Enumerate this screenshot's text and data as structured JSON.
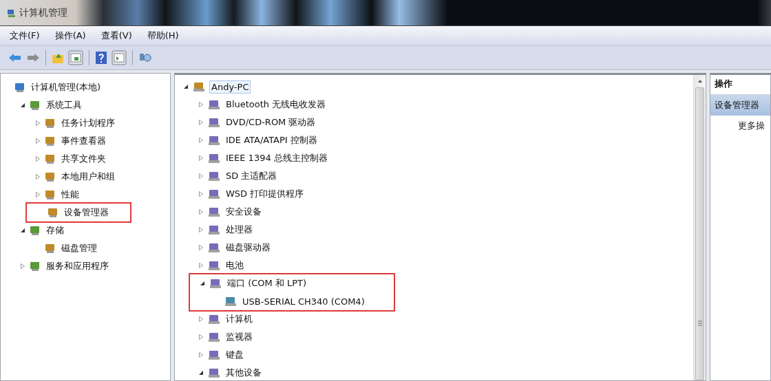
{
  "window": {
    "title": "计算机管理"
  },
  "menu": [
    "文件(F)",
    "操作(A)",
    "查看(V)",
    "帮助(H)"
  ],
  "left_tree": [
    {
      "label": "计算机管理(本地)",
      "highlighted": false,
      "children": [
        {
          "label": "系统工具",
          "expanded": true,
          "highlighted": false,
          "children": [
            {
              "label": "任务计划程序",
              "expanded": false,
              "highlighted": false
            },
            {
              "label": "事件查看器",
              "expanded": false,
              "highlighted": false
            },
            {
              "label": "共享文件夹",
              "expanded": false,
              "highlighted": false
            },
            {
              "label": "本地用户和组",
              "expanded": false,
              "highlighted": false
            },
            {
              "label": "性能",
              "expanded": false,
              "highlighted": false
            },
            {
              "label": "设备管理器",
              "highlighted": true
            }
          ]
        },
        {
          "label": "存储",
          "expanded": true,
          "highlighted": false,
          "children": [
            {
              "label": "磁盘管理",
              "highlighted": false
            }
          ]
        },
        {
          "label": "服务和应用程序",
          "expanded": false,
          "highlighted": false
        }
      ]
    }
  ],
  "device_tree": [
    {
      "label": "Andy-PC",
      "expanded": true,
      "selected": true,
      "highlighted": false,
      "children": [
        {
          "label": "Bluetooth 无线电收发器",
          "expanded": false,
          "selected": false,
          "highlighted": false
        },
        {
          "label": "DVD/CD-ROM 驱动器",
          "expanded": false,
          "selected": false,
          "highlighted": false
        },
        {
          "label": "IDE ATA/ATAPI 控制器",
          "expanded": false,
          "selected": false,
          "highlighted": false
        },
        {
          "label": "IEEE 1394 总线主控制器",
          "expanded": false,
          "selected": false,
          "highlighted": false
        },
        {
          "label": "SD 主适配器",
          "expanded": false,
          "selected": false,
          "highlighted": false
        },
        {
          "label": "WSD 打印提供程序",
          "expanded": false,
          "selected": false,
          "highlighted": false
        },
        {
          "label": "安全设备",
          "expanded": false,
          "selected": false,
          "highlighted": false
        },
        {
          "label": "处理器",
          "expanded": false,
          "selected": false,
          "highlighted": false
        },
        {
          "label": "磁盘驱动器",
          "expanded": false,
          "selected": false,
          "highlighted": false
        },
        {
          "label": "电池",
          "expanded": false,
          "selected": false,
          "highlighted": false
        },
        {
          "label": "端口 (COM 和 LPT)",
          "expanded": true,
          "selected": false,
          "highlighted": true,
          "children": [
            {
              "label": "USB-SERIAL CH340 (COM4)",
              "selected": false
            }
          ]
        },
        {
          "label": "计算机",
          "expanded": false,
          "selected": false,
          "highlighted": false
        },
        {
          "label": "监视器",
          "expanded": false,
          "selected": false,
          "highlighted": false
        },
        {
          "label": "键盘",
          "expanded": false,
          "selected": false,
          "highlighted": false
        },
        {
          "label": "其他设备",
          "expanded": true,
          "selected": false,
          "highlighted": false
        }
      ]
    }
  ],
  "actions": {
    "title": "操作",
    "items": [
      {
        "label": "设备管理器",
        "kind": "section",
        "selected": true
      },
      {
        "label": "更多操",
        "kind": "action",
        "selected": false
      }
    ]
  }
}
